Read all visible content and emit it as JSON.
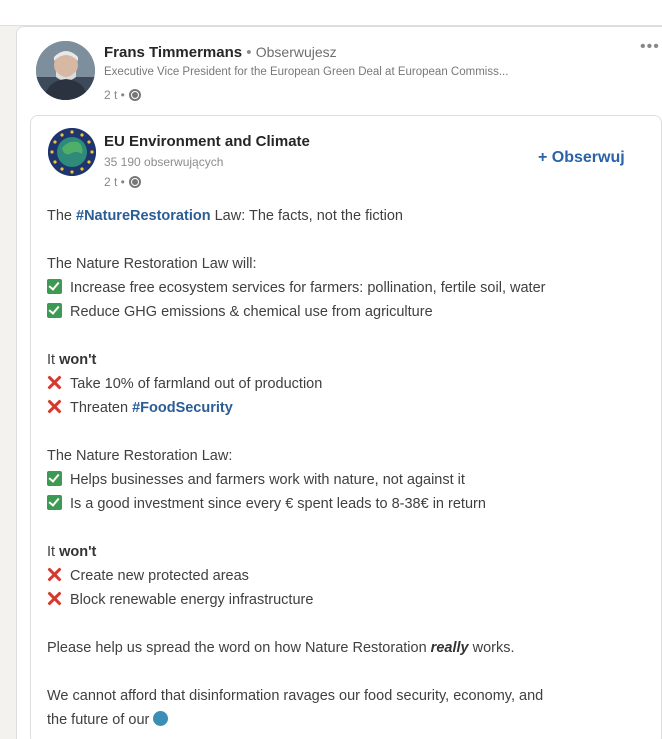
{
  "author": {
    "name": "Frans Timmermans",
    "separator": "•",
    "follow_state": "Obserwujesz",
    "headline": "Executive Vice President for the European Green Deal at European Commiss...",
    "time": "2 t •"
  },
  "organization": {
    "name": "EU Environment and Climate",
    "followers": "35 190 obserwujących",
    "time": "2 t •",
    "follow_label": "+ Obserwuj"
  },
  "post": {
    "title_prefix": "The ",
    "title_hashtag": "#NatureRestoration",
    "title_suffix": " Law: The facts, not the fiction",
    "section1_intro": "The Nature Restoration Law will:",
    "section1_items": [
      "Increase free ecosystem services for farmers: pollination, fertile soil, water",
      "Reduce GHG emissions & chemical use from agriculture"
    ],
    "wont_prefix": "It ",
    "wont_word": "won't",
    "section1_wont_items": [
      "Take 10% of farmland out of production",
      "Threaten "
    ],
    "food_security_hashtag": "#FoodSecurity",
    "section2_intro": "The Nature Restoration Law:",
    "section2_items": [
      "Helps businesses and farmers work with nature, not against it",
      "Is a good investment since every € spent leads to 8-38€ in return"
    ],
    "section2_wont_items": [
      "Create new protected areas",
      "Block renewable energy infrastructure"
    ],
    "help_prefix": "Please help us spread the word on how Nature Restoration ",
    "help_emph": "really",
    "help_suffix": " works.",
    "closing_line1": "We cannot afford that disinformation ravages our food security, economy, and",
    "closing_line2": "the future of our"
  },
  "icons": {
    "globe": "globe-icon",
    "check": "check-icon",
    "cross": "cross-icon",
    "earth": "earth-globe-emoji",
    "more": "more-options-icon",
    "check_color": "#3d9a53",
    "cross_color": "#d8372c",
    "link_color": "#2a5c95"
  }
}
